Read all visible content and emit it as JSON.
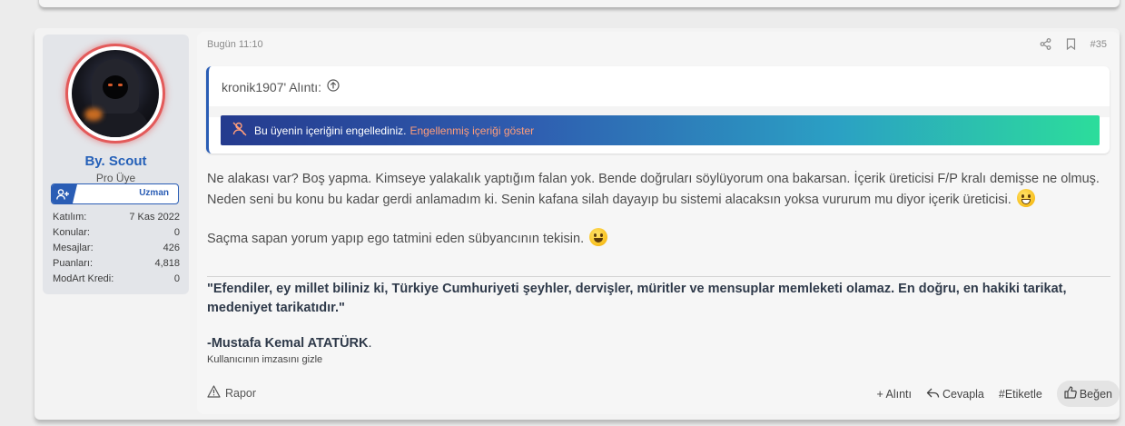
{
  "post": {
    "user": {
      "username": "By. Scout",
      "title": "Pro Üye",
      "rank": "Uzman",
      "stats": [
        {
          "label": "Katılım:",
          "value": "7 Kas 2022"
        },
        {
          "label": "Konular:",
          "value": "0"
        },
        {
          "label": "Mesajlar:",
          "value": "426"
        },
        {
          "label": "Puanları:",
          "value": "4,818"
        },
        {
          "label": "ModArt Kredi:",
          "value": "0"
        }
      ]
    },
    "timestamp": "Bugün 11:10",
    "post_number": "#35",
    "quote": {
      "author": "kronik1907' Alıntı:",
      "blocked_text": "Bu üyenin içeriğini engellediniz.",
      "blocked_link": "Engellenmiş içeriği göster"
    },
    "body": {
      "p1": "Ne alakası var? Boş yapma. Kimseye yalakalık yaptığım falan yok. Bende doğruları söylüyorum ona bakarsan. İçerik üreticisi F/P kralı demişse ne olmuş. Neden seni bu konu bu kadar gerdi anlamadım ki. Senin kafana silah dayayıp bu sistemi alacaksın yoksa vururum mu diyor içerik üreticisi.",
      "p2": "Saçma sapan yorum yapıp ego tatmini eden sübyancının tekisin."
    },
    "signature": {
      "quote": "\"Efendiler, ey millet biliniz ki, Türkiye Cumhuriyeti şeyhler, dervişler, müritler ve mensuplar memleketi olamaz. En doğru, en hakiki tarikat, medeniyet tarikatıdır.\"",
      "author": "-Mustafa Kemal ATATÜRK",
      "author_suffix": ".",
      "hide_label": "Kullanıcının imzasını gizle"
    },
    "footer": {
      "report": "Rapor",
      "quote": "+ Alıntı",
      "reply": "Cevapla",
      "tag": "#Etiketle",
      "like": "Beğen"
    }
  },
  "icons": {
    "share": "share-icon",
    "bookmark": "bookmark-icon",
    "quote_up": "arrow-up-circle-icon",
    "blocked": "muted-user-icon",
    "report": "warning-icon",
    "reply": "reply-icon",
    "like": "thumbs-up-icon",
    "rank": "user-plus-icon"
  },
  "colors": {
    "accent": "#2a5db5",
    "username": "#2560b8",
    "blocked_link": "#ff9d7a",
    "avatar_ring": "#e35a5a"
  }
}
